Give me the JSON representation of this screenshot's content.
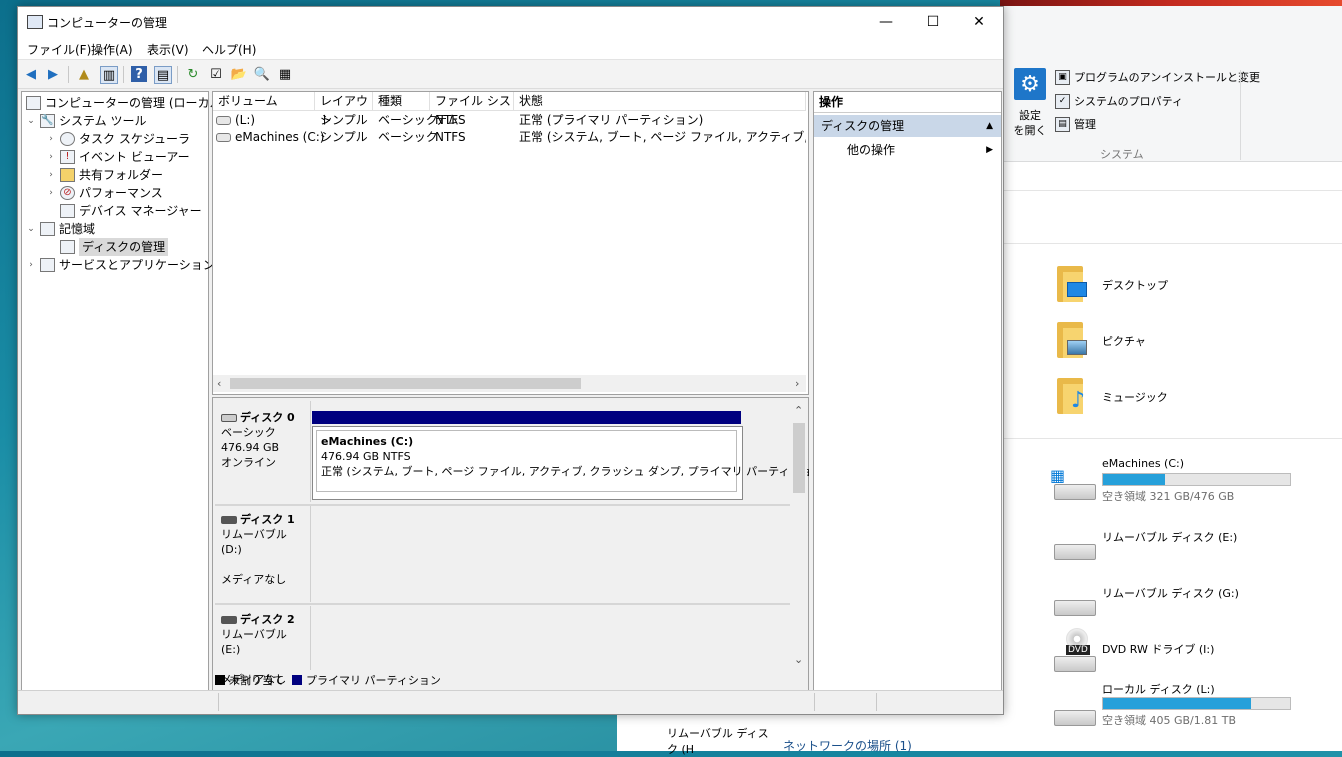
{
  "explorer": {
    "ribbon": {
      "settings_label": "設定\nを開く",
      "uninstall": "プログラムのアンインストールと変更",
      "system_props": "システムのプロパティ",
      "manage": "管理",
      "group_label": "システム"
    },
    "folders": [
      {
        "name": "デスクトップ"
      },
      {
        "name": "ピクチャ"
      },
      {
        "name": "ミュージック"
      }
    ],
    "drives": [
      {
        "name": "eMachines (C:)",
        "free_text": "空き領域 321 GB/476 GB",
        "used_fraction": 0.33
      },
      {
        "name": "リムーバブル ディスク (E:)"
      },
      {
        "name": "リムーバブル ディスク (G:)"
      },
      {
        "name": "DVD RW ドライブ (I:)",
        "badge": "DVD"
      },
      {
        "name": "ローカル ディスク (L:)",
        "free_text": "空き領域 405 GB/1.81 TB",
        "used_fraction": 0.79
      }
    ],
    "behind_row": "リムーバブル ディスク (H",
    "network_label": "ネットワークの場所 (1)"
  },
  "window": {
    "title": "コンピューターの管理",
    "controls": {
      "minimize": "—",
      "maximize": "☐",
      "close": "✕"
    }
  },
  "menu": [
    "ファイル(F)",
    "操作(A)",
    "表示(V)",
    "ヘルプ(H)"
  ],
  "tree": {
    "root": "コンピューターの管理 (ローカル)",
    "system_tools": "システム ツール",
    "task_scheduler": "タスク スケジューラ",
    "event_viewer": "イベント ビューアー",
    "shared_folders": "共有フォルダー",
    "performance": "パフォーマンス",
    "device_manager": "デバイス マネージャー",
    "storage": "記憶域",
    "disk_management": "ディスクの管理",
    "services_apps": "サービスとアプリケーション"
  },
  "volumes": {
    "headers": [
      "ボリューム",
      "レイアウト",
      "種類",
      "ファイル システム",
      "状態"
    ],
    "rows": [
      {
        "volume": "(L:)",
        "layout": "シンプル",
        "type": "ベーシック",
        "fs": "NTFS",
        "status": "正常 (プライマリ パーティション)"
      },
      {
        "volume": "eMachines (C:)",
        "layout": "シンプル",
        "type": "ベーシック",
        "fs": "NTFS",
        "status": "正常 (システム, ブート, ページ ファイル, アクティブ, クラッシュ ダンプ"
      }
    ]
  },
  "disks": [
    {
      "name": "ディスク 0",
      "type": "ベーシック",
      "size": "476.94 GB",
      "state": "オンライン",
      "partition": {
        "name": "eMachines  (C:)",
        "size": "476.94 GB NTFS",
        "status": "正常 (システム, ブート, ページ ファイル, アクティブ, クラッシュ ダンプ, プライマリ パーティション)"
      }
    },
    {
      "name": "ディスク 1",
      "type": "リムーバブル (D:)",
      "state": "メディアなし"
    },
    {
      "name": "ディスク 2",
      "type": "リムーバブル (E:)",
      "state": "メディアなし"
    }
  ],
  "legend": {
    "unallocated": "未割り当て",
    "primary": "プライマリ パーティション",
    "unallocated_color": "#000000",
    "primary_color": "#00007f"
  },
  "actions": {
    "header": "操作",
    "section": "ディスクの管理",
    "more": "他の操作"
  }
}
